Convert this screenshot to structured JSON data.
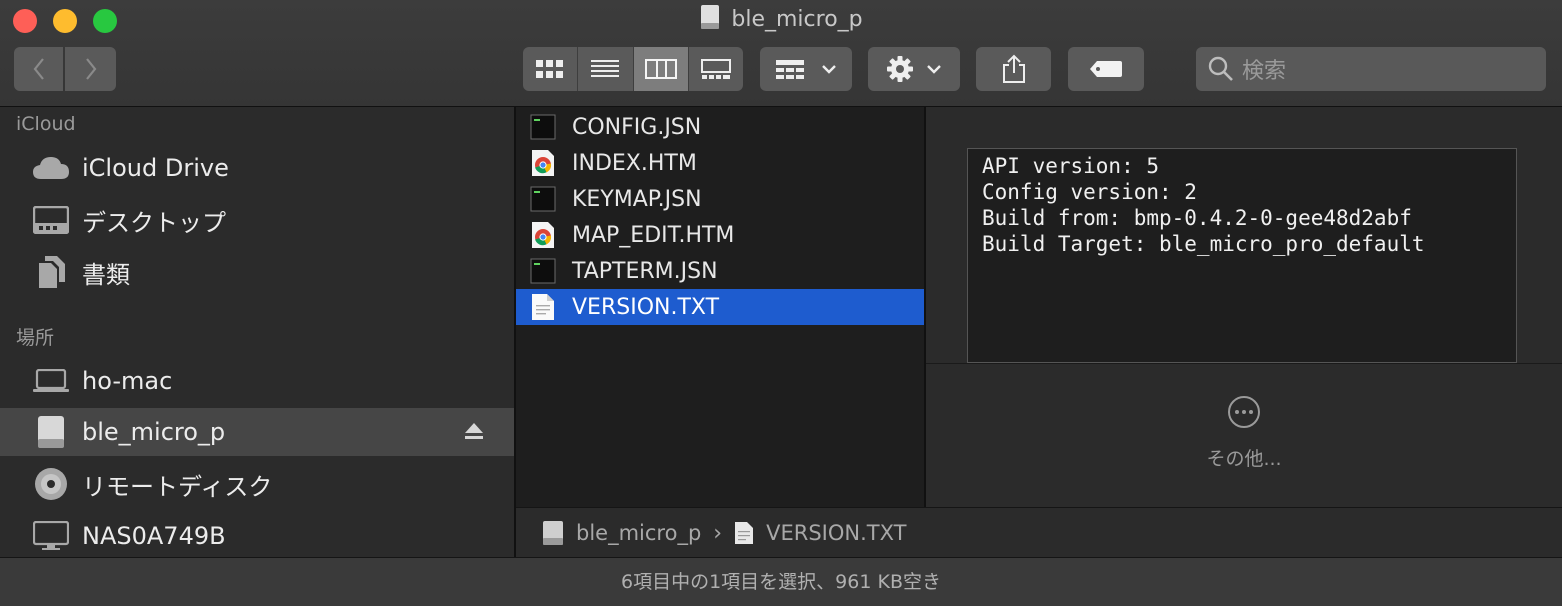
{
  "window": {
    "title": "ble_micro_p"
  },
  "toolbar": {
    "search_placeholder": "検索",
    "view_modes": [
      "icon",
      "list",
      "column",
      "gallery"
    ],
    "active_view": "column"
  },
  "sidebar": {
    "sections": [
      {
        "title": "iCloud",
        "items": [
          {
            "label": "iCloud Drive",
            "icon": "cloud-icon"
          },
          {
            "label": "デスクトップ",
            "icon": "desktop-folder-icon"
          },
          {
            "label": "書類",
            "icon": "documents-icon"
          }
        ]
      },
      {
        "title": "場所",
        "items": [
          {
            "label": "ho-mac",
            "icon": "laptop-icon"
          },
          {
            "label": "ble_micro_p",
            "icon": "external-drive-icon",
            "selected": true
          },
          {
            "label": "リモートディスク",
            "icon": "disc-icon"
          },
          {
            "label": "NAS0A749B",
            "icon": "network-display-icon"
          }
        ]
      }
    ]
  },
  "files": [
    {
      "name": "CONFIG.JSN",
      "icon": "terminal-file-icon"
    },
    {
      "name": "INDEX.HTM",
      "icon": "chrome-file-icon"
    },
    {
      "name": "KEYMAP.JSN",
      "icon": "terminal-file-icon"
    },
    {
      "name": "MAP_EDIT.HTM",
      "icon": "chrome-file-icon"
    },
    {
      "name": "TAPTERM.JSN",
      "icon": "terminal-file-icon"
    },
    {
      "name": "VERSION.TXT",
      "icon": "text-file-icon",
      "selected": true
    }
  ],
  "preview": {
    "lines": [
      "API version: 5",
      "Config version: 2",
      "Build from: bmp-0.4.2-0-gee48d2abf",
      "Build Target: ble_micro_pro_default"
    ],
    "more_label": "その他..."
  },
  "pathbar": {
    "items": [
      "ble_micro_p",
      "VERSION.TXT"
    ]
  },
  "status": {
    "text": "6項目中の1項目を選択、961 KB空き"
  },
  "colors": {
    "selection": "#1e5ccf",
    "sidebar_selected": "#464646"
  }
}
